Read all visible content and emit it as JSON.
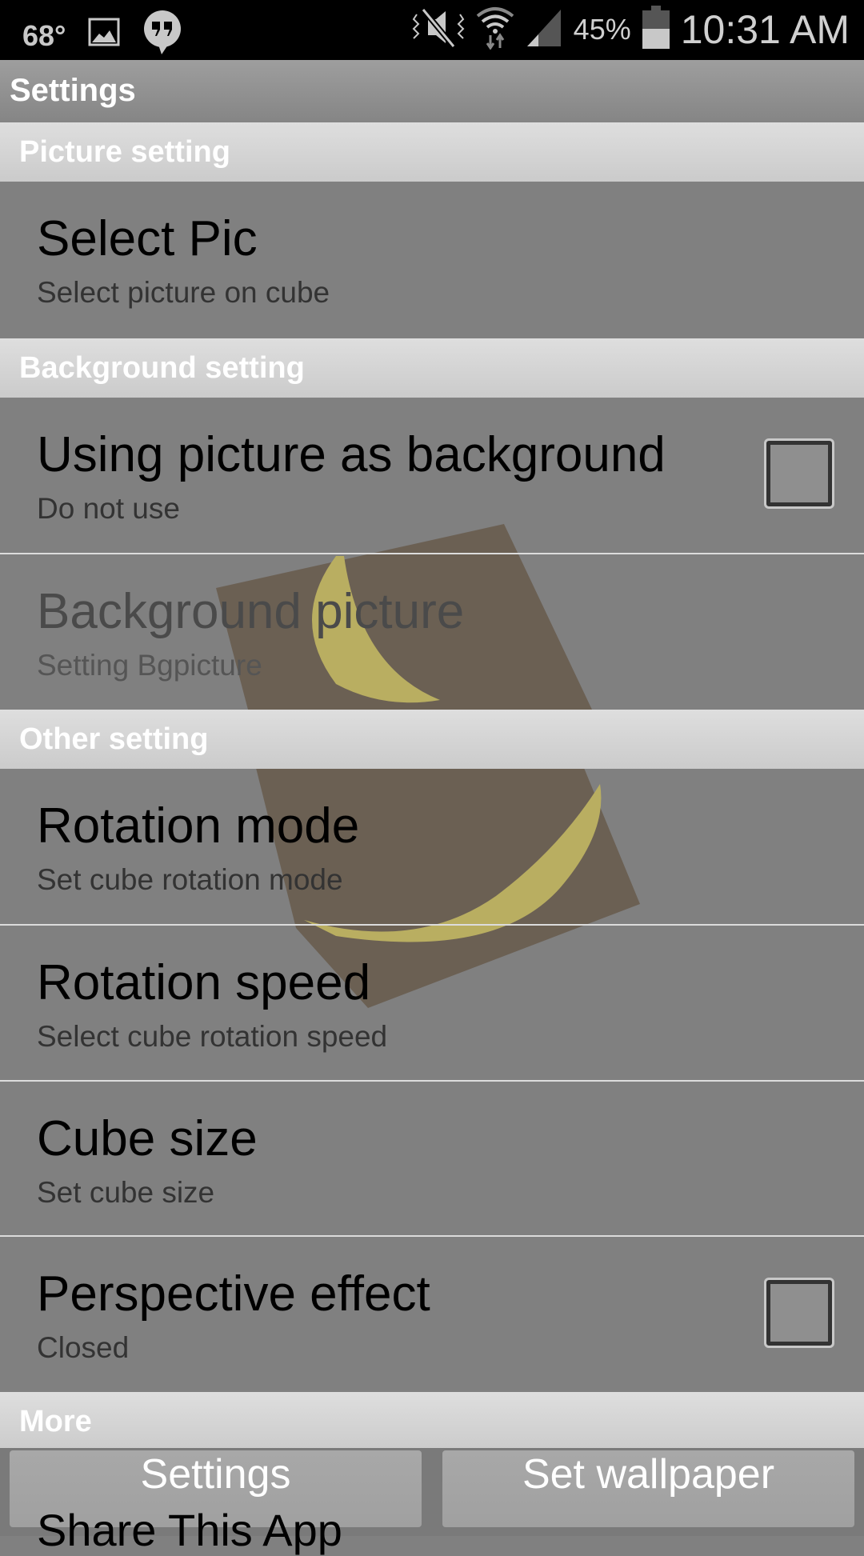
{
  "status_bar": {
    "temperature": "68°",
    "battery_percent": "45%",
    "battery_level": 0.45,
    "time": "10:31 AM",
    "icons": [
      "gallery-icon",
      "hangouts-icon",
      "vibrate-mute-icon",
      "wifi-icon",
      "signal-icon",
      "battery-icon"
    ]
  },
  "title_bar": {
    "title": "Settings"
  },
  "sections": [
    {
      "header": "Picture setting",
      "items": [
        {
          "title": "Select Pic",
          "summary": "Select picture on cube"
        }
      ]
    },
    {
      "header": "Background setting",
      "items": [
        {
          "title": "Using picture as background",
          "summary": "Do not use",
          "checkbox": true,
          "checked": false
        },
        {
          "title": "Background picture",
          "summary": "Setting Bgpicture",
          "enabled": false
        }
      ]
    },
    {
      "header": "Other setting",
      "items": [
        {
          "title": "Rotation mode",
          "summary": "Set cube rotation mode"
        },
        {
          "title": "Rotation speed",
          "summary": "Select cube rotation speed"
        },
        {
          "title": "Cube size",
          "summary": "Set cube size"
        },
        {
          "title": "Perspective effect",
          "summary": "Closed",
          "checkbox": true,
          "checked": false
        }
      ]
    },
    {
      "header": "More",
      "items": [
        {
          "title": "Share This App"
        }
      ]
    }
  ],
  "bottom_buttons": {
    "settings": "Settings",
    "set_wallpaper": "Set wallpaper"
  }
}
